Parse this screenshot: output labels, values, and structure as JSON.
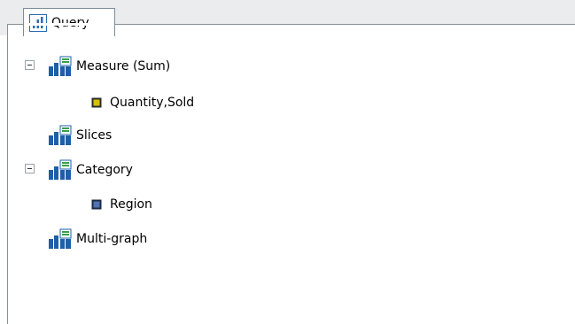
{
  "tab": {
    "label": "Query",
    "icon": "bar-chart-icon"
  },
  "tree": {
    "measure": {
      "label": "Measure (Sum)",
      "icon": "chart-field-icon",
      "expanded": true
    },
    "measure_child": {
      "label": "Quantity,Sold",
      "icon": "measure-field-icon",
      "color": "#c8b400"
    },
    "slices": {
      "label": "Slices",
      "icon": "chart-field-icon"
    },
    "category": {
      "label": "Category",
      "icon": "chart-field-icon",
      "expanded": true
    },
    "category_child": {
      "label": "Region",
      "icon": "dimension-field-icon",
      "color": "#3e5a8a"
    },
    "multigraph": {
      "label": "Multi-graph",
      "icon": "chart-field-icon"
    }
  },
  "colors": {
    "frame": "#8a8f95",
    "header_bg": "#eaeced",
    "icon_blue": "#1f5ea8",
    "icon_green": "#3aa04a"
  }
}
